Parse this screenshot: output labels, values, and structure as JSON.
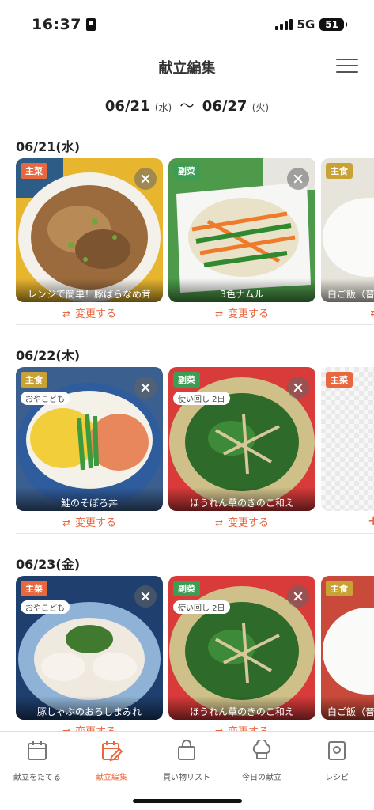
{
  "status_bar": {
    "time": "16:37",
    "network": "5G",
    "battery": "51"
  },
  "header": {
    "title": "献立編集",
    "menu_icon": "hamburger-menu-icon"
  },
  "date_range": {
    "start": "06/21",
    "start_dow": "(水)",
    "separator": "〜",
    "end": "06/27",
    "end_dow": "(火)"
  },
  "change_label": "変更する",
  "days": [
    {
      "label": "06/21(水)",
      "cards": [
        {
          "tag": "主菜",
          "name": "レンジで簡単！豚ばらなめ茸"
        },
        {
          "tag": "副菜",
          "name": "3色ナムル"
        },
        {
          "tag": "主食",
          "name": "白ご飯（普"
        }
      ]
    },
    {
      "label": "06/22(木)",
      "cards": [
        {
          "tag": "主食",
          "sub_tag": "おやこども",
          "name": "鮭のそぼろ丼"
        },
        {
          "tag": "副菜",
          "sub_tag": "使い回し 2日",
          "name": "ほうれん草のきのこ和え"
        },
        {
          "tag": "主菜",
          "name": ""
        }
      ]
    },
    {
      "label": "06/23(金)",
      "cards": [
        {
          "tag": "主菜",
          "sub_tag": "おやこども",
          "name": "豚しゃぶのおろしまみれ"
        },
        {
          "tag": "副菜",
          "sub_tag": "使い回し 2日",
          "name": "ほうれん草のきのこ和え"
        },
        {
          "tag": "主食",
          "name": "白ご飯（普"
        }
      ]
    }
  ],
  "tabs": [
    {
      "label": "献立をたてる",
      "icon": "calendar-icon"
    },
    {
      "label": "献立編集",
      "icon": "calendar-edit-icon",
      "active": true
    },
    {
      "label": "買い物リスト",
      "icon": "shopping-bag-icon"
    },
    {
      "label": "今日の献立",
      "icon": "chef-hat-icon"
    },
    {
      "label": "レシピ",
      "icon": "recipe-book-icon"
    }
  ],
  "colors": {
    "accent": "#e8673f",
    "main_tag": "#e8673f",
    "side_tag": "#3c9e54",
    "staple_tag": "#c9a235"
  }
}
